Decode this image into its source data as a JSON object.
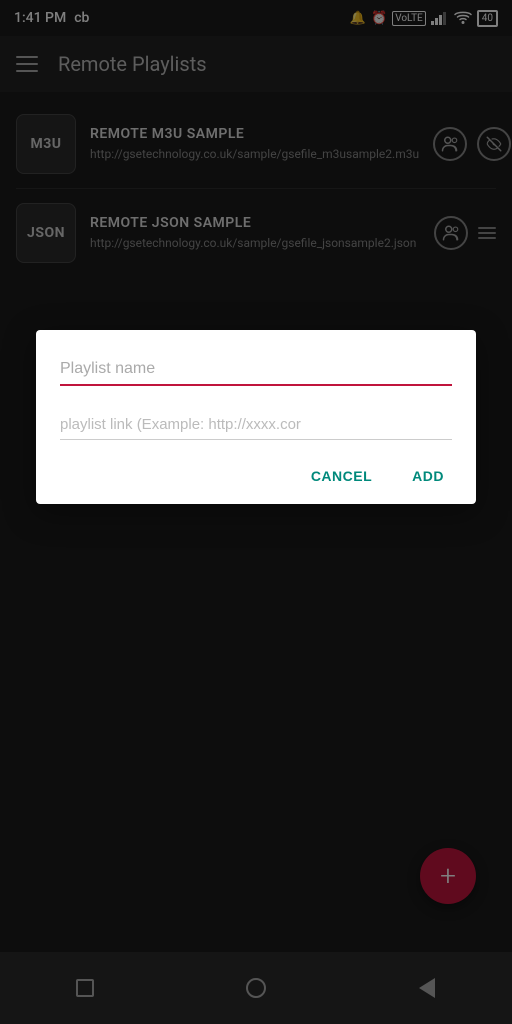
{
  "statusBar": {
    "time": "1:41 PM",
    "carrier": "cb",
    "battery": "40"
  },
  "appBar": {
    "title": "Remote Playlists"
  },
  "playlists": [
    {
      "id": "m3u",
      "type": "M3U",
      "name": "REMOTE M3U SAMPLE",
      "url": "http://gsetechnology.co.uk/sample/gsefile_m3usample2.m3u",
      "hasEyeIcon": true
    },
    {
      "id": "json",
      "type": "JSON",
      "name": "REMOTE JSON SAMPLE",
      "url": "http://gsetechnology.co.uk/sample/gsefile_jsonsample2.json",
      "hasEyeIcon": false
    }
  ],
  "dialog": {
    "nameLabel": "Playlist name",
    "linkLabel": "playlist link (Example: http://xxxx.cor",
    "cancelLabel": "CANCEL",
    "addLabel": "ADD"
  },
  "fab": {
    "label": "+"
  }
}
